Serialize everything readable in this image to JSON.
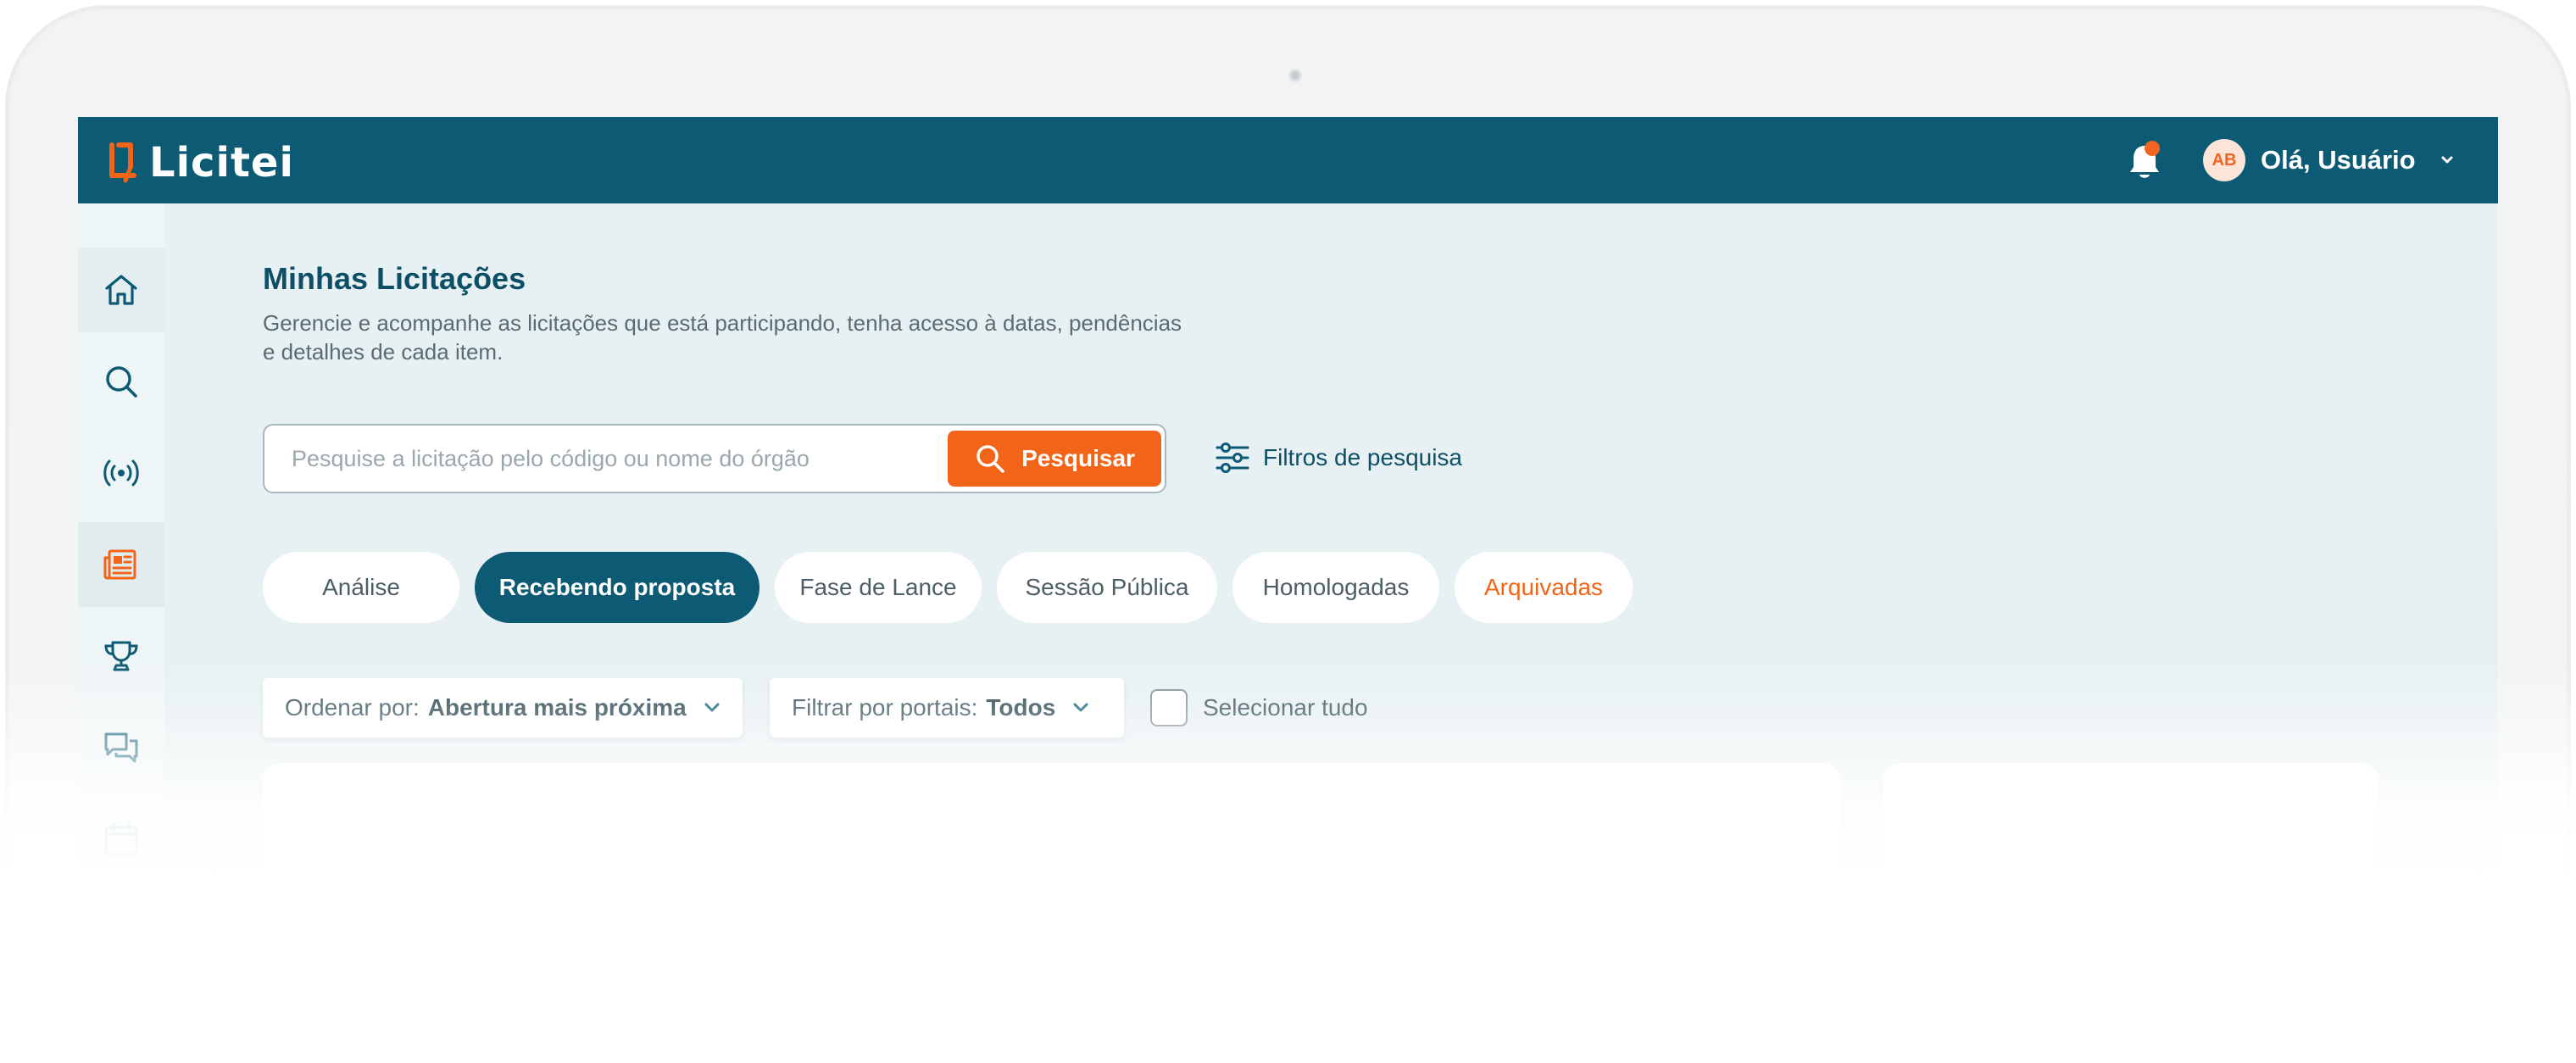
{
  "brand": {
    "name": "Licitei"
  },
  "header": {
    "avatar_initials": "AB",
    "greeting": "Olá, Usuário",
    "notification_dot_color": "#f26522"
  },
  "sidebar": {
    "items": [
      {
        "icon": "home-icon"
      },
      {
        "icon": "search-icon"
      },
      {
        "icon": "broadcast-icon"
      },
      {
        "icon": "newspaper-icon",
        "active": true
      },
      {
        "icon": "trophy-icon"
      },
      {
        "icon": "chat-icon"
      },
      {
        "icon": "calendar-icon"
      }
    ]
  },
  "page": {
    "title": "Minhas Licitações",
    "subtitle": "Gerencie e acompanhe as licitações que está participando, tenha acesso à datas, pendências e detalhes de cada item."
  },
  "search": {
    "placeholder": "Pesquise a licitação pelo código ou nome do órgão",
    "button_label": "Pesquisar",
    "filters_label": "Filtros de pesquisa"
  },
  "tabs": [
    {
      "label": "Análise"
    },
    {
      "label": "Recebendo proposta",
      "active": true
    },
    {
      "label": "Fase de Lance"
    },
    {
      "label": "Sessão Pública"
    },
    {
      "label": "Homologadas"
    },
    {
      "label": "Arquivadas"
    }
  ],
  "controls": {
    "sort_label": "Ordenar por:",
    "sort_value": "Abertura mais próxima",
    "portal_label": "Filtrar por portais:",
    "portal_value": "Todos",
    "select_all_label": "Selecionar tudo"
  },
  "colors": {
    "primary": "#0d5a74",
    "accent": "#f26418",
    "background": "#e7f0f2"
  }
}
